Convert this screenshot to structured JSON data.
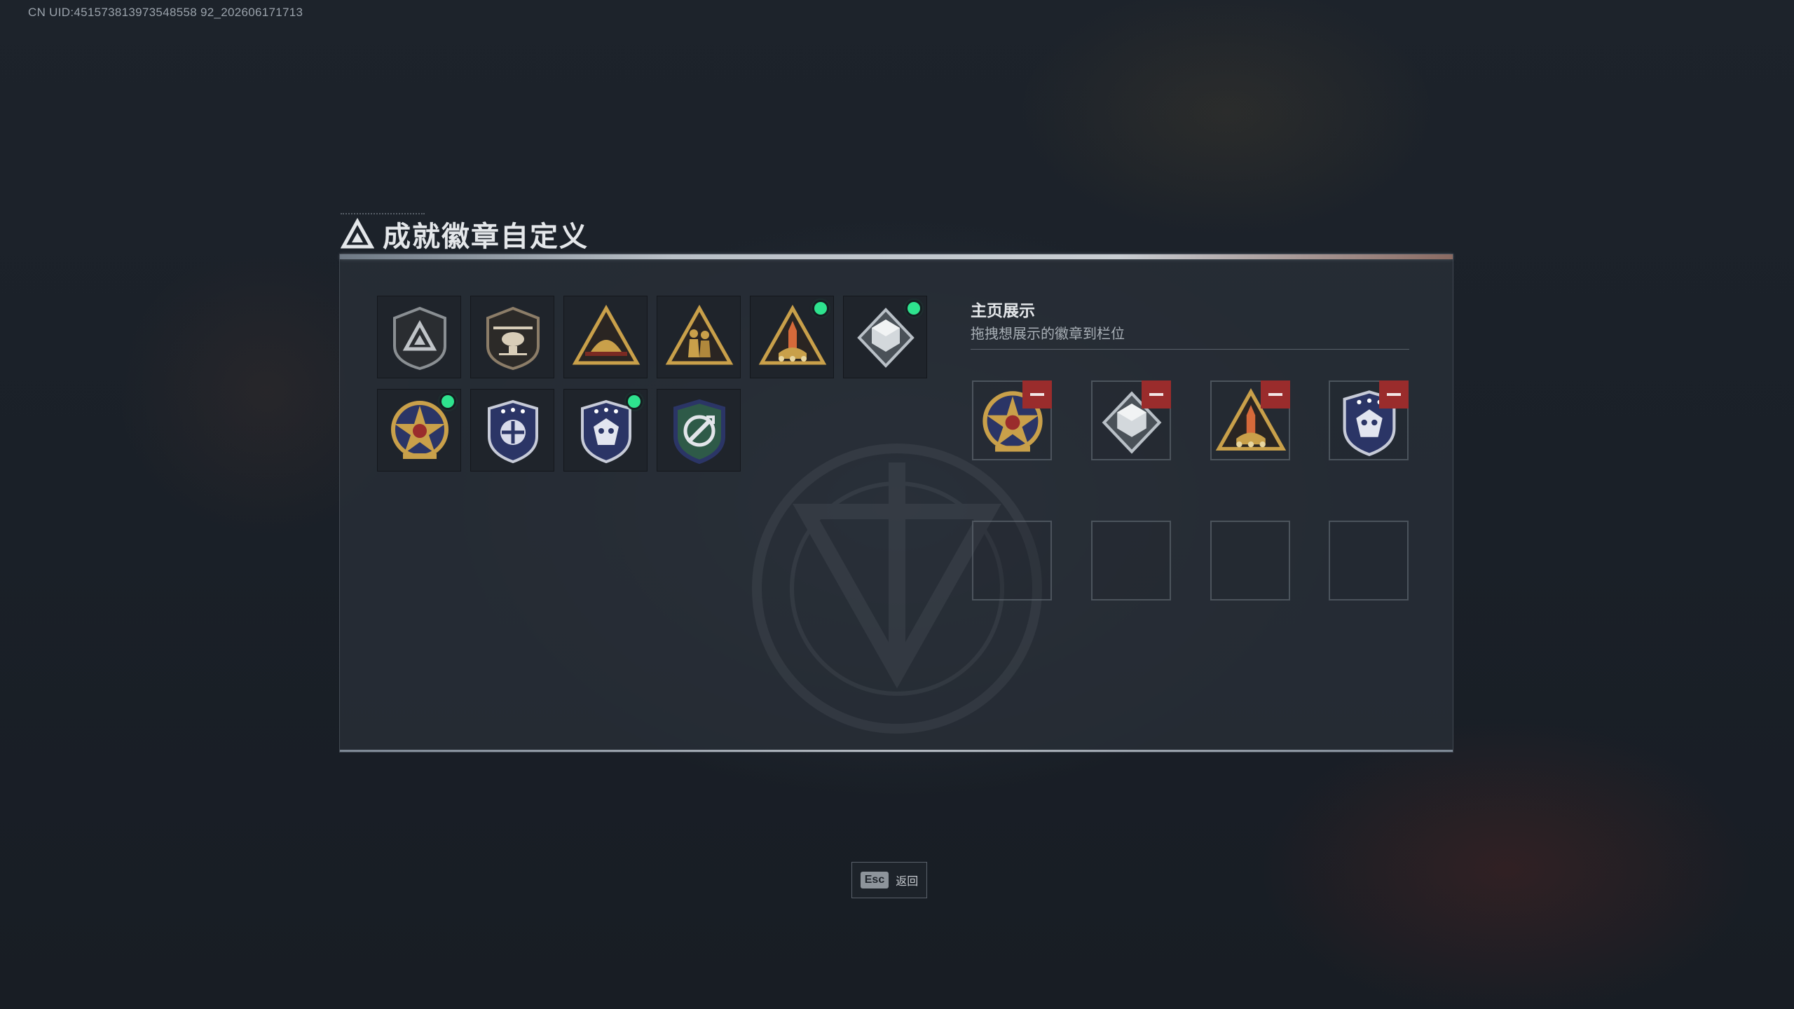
{
  "uid_text": "CN UID:451573813973548558 92_202606171713",
  "title": "成就徽章自定义",
  "colors": {
    "accent_new": "#2ee38e",
    "remove": "#9a2c2c",
    "gold": "#c9a04a",
    "navy": "#2b3566"
  },
  "badges": [
    {
      "icon": "shield-emblem-icon",
      "new": false
    },
    {
      "icon": "helicopter-badge-icon",
      "new": false
    },
    {
      "icon": "helmet-triangle-icon",
      "new": false
    },
    {
      "icon": "soldiers-triangle-icon",
      "new": false
    },
    {
      "icon": "rocket-triangle-icon",
      "new": true
    },
    {
      "icon": "silver-diamond-icon",
      "new": true
    },
    {
      "icon": "star-medal-icon",
      "new": true
    },
    {
      "icon": "navy-shield-wings-icon",
      "new": false
    },
    {
      "icon": "navy-shield-skull-icon",
      "new": true
    },
    {
      "icon": "green-shield-tools-icon",
      "new": false
    }
  ],
  "showcase": {
    "title": "主页展示",
    "subtitle": "拖拽想展示的徽章到栏位",
    "slots": [
      {
        "icon": "star-medal-icon",
        "filled": true
      },
      {
        "icon": "silver-diamond-icon",
        "filled": true
      },
      {
        "icon": "rocket-triangle-icon",
        "filled": true
      },
      {
        "icon": "navy-shield-skull-icon",
        "filled": true
      },
      {
        "filled": false
      },
      {
        "filled": false
      },
      {
        "filled": false
      },
      {
        "filled": false
      }
    ]
  },
  "esc": {
    "key": "Esc",
    "label": "返回"
  }
}
